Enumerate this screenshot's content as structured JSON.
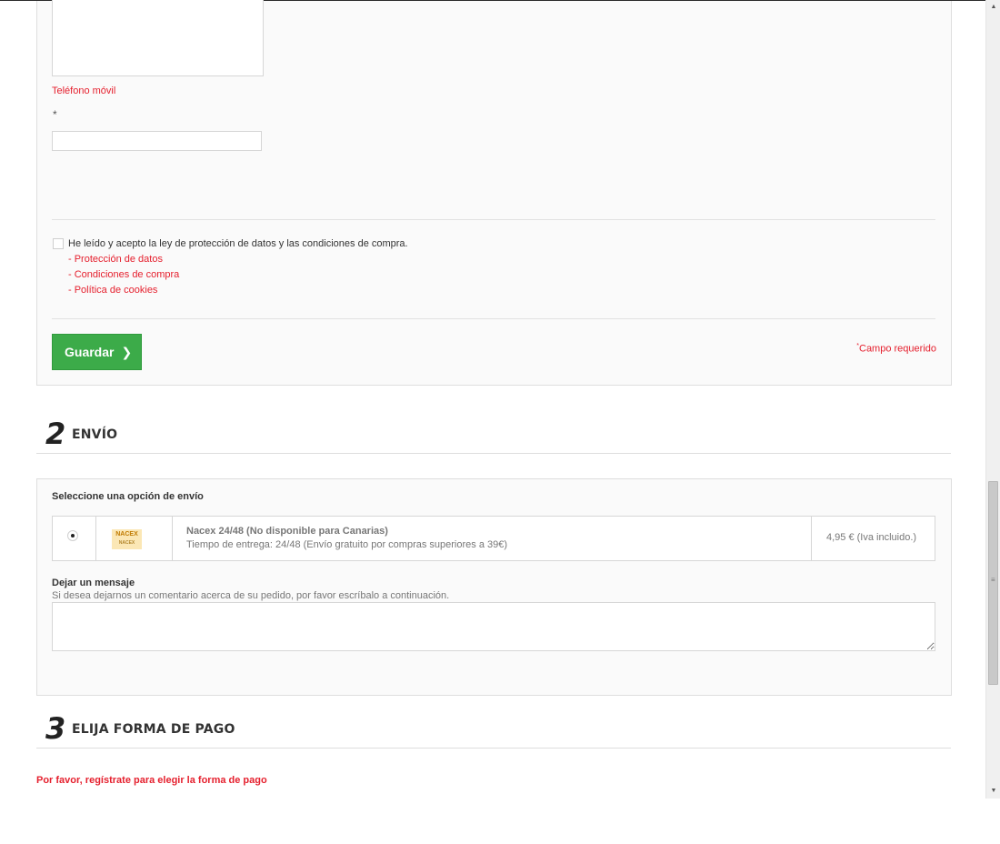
{
  "form": {
    "mobile_label": "Teléfono móvil",
    "required_mark": "*",
    "mobile_value": "",
    "accept_text": "He leído y acepto la ley de protección de datos y las condiciones de compra.",
    "links": [
      "- Protección de datos",
      "- Condiciones de compra",
      "- Política de cookies"
    ],
    "save_label": "Guardar",
    "required_note_mark": "*",
    "required_note": "Campo requerido"
  },
  "section2": {
    "number": "2",
    "title": "ENVÍO",
    "panel_title": "Seleccione una opción de envío",
    "carrier": {
      "logo_text": "NACEX",
      "logo_subtext": "NACEX",
      "name": "Nacex 24/48 (No disponible para Canarias)",
      "delivery": "Tiempo de entrega: 24/48 (Envío gratuito por compras superiores a 39€)",
      "price": "4,95 € (Iva incluido.)",
      "selected": true
    },
    "message_title": "Dejar un mensaje",
    "message_hint": "Si desea dejarnos un comentario acerca de su pedido, por favor escríbalo a continuación.",
    "message_value": ""
  },
  "section3": {
    "number": "3",
    "title": "ELIJA FORMA DE PAGO",
    "notice": "Por favor, regístrate para elegir la forma de pago"
  },
  "icons": {
    "save_chevron": "chevron-right-icon",
    "scroll_up": "arrow-up-icon",
    "scroll_down": "arrow-down-icon"
  },
  "colors": {
    "accent_red": "#e5202e",
    "button_green": "#3cab49",
    "panel_bg": "#fafafa",
    "border": "#dedede"
  }
}
